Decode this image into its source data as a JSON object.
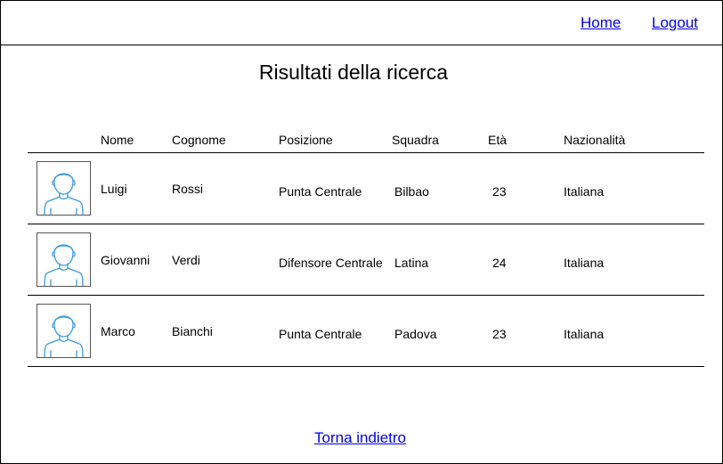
{
  "nav": {
    "home_label": "Home",
    "logout_label": "Logout"
  },
  "page": {
    "title": "Risultati della ricerca",
    "back_label": "Torna indietro"
  },
  "table": {
    "headers": {
      "nome": "Nome",
      "cognome": "Cognome",
      "posizione": "Posizione",
      "squadra": "Squadra",
      "eta": "Età",
      "nazionalita": "Nazionalità"
    },
    "rows": [
      {
        "avatar_icon": "user-avatar-icon",
        "nome": "Luigi",
        "cognome": "Rossi",
        "posizione": "Punta Centrale",
        "squadra": "Bilbao",
        "eta": "23",
        "nazionalita": "Italiana"
      },
      {
        "avatar_icon": "user-avatar-icon",
        "nome": "Giovanni",
        "cognome": "Verdi",
        "posizione": "Difensore Centrale",
        "squadra": "Latina",
        "eta": "24",
        "nazionalita": "Italiana"
      },
      {
        "avatar_icon": "user-avatar-icon",
        "nome": "Marco",
        "cognome": "Bianchi",
        "posizione": "Punta Centrale",
        "squadra": "Padova",
        "eta": "23",
        "nazionalita": "Italiana"
      }
    ]
  },
  "colors": {
    "link": "#0000ee",
    "avatar_stroke": "#3c9be0"
  }
}
